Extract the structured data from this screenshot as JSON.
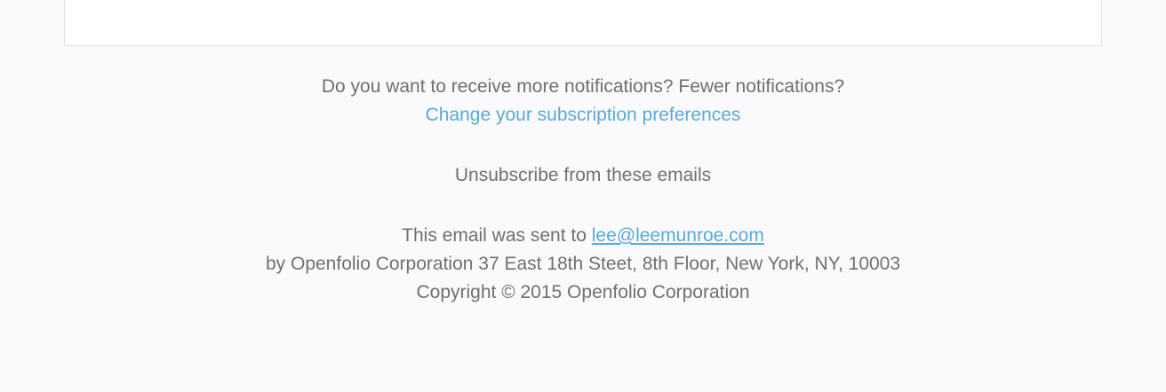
{
  "footer": {
    "notifications_question": "Do you want to receive more notifications? Fewer notifications?",
    "change_prefs_link": "Change your subscription preferences",
    "unsubscribe_link": "Unsubscribe from these emails",
    "sent_to_prefix": "This email was sent to ",
    "sent_to_email": "lee@leemunroe.com",
    "address_line": "by Openfolio Corporation 37 East 18th Steet, 8th Floor, New York, NY, 10003",
    "copyright": "Copyright © 2015 Openfolio Corporation"
  },
  "colors": {
    "link": "#5aa9d6",
    "text": "#707070",
    "background": "#fafafc"
  }
}
